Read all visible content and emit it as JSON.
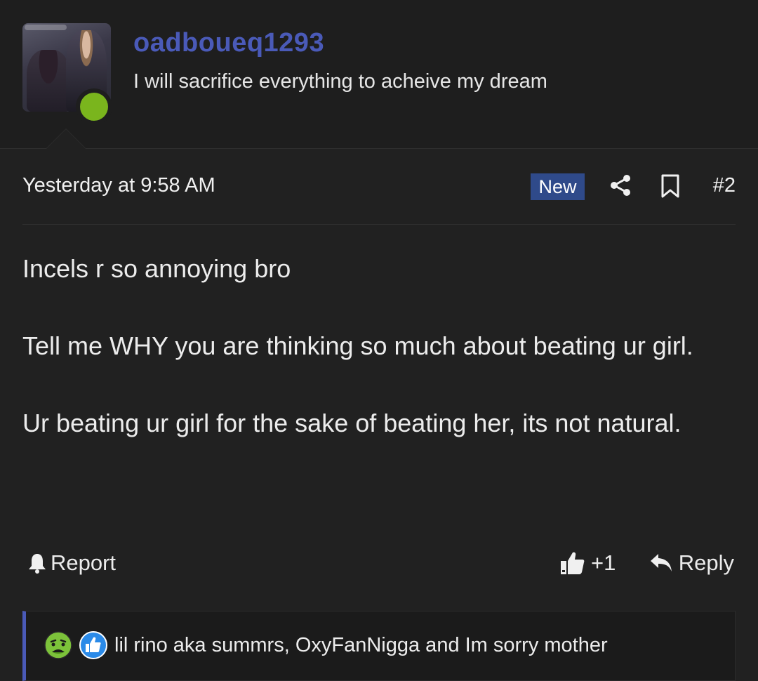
{
  "author": {
    "username": "oadboueq1293",
    "tagline": "I will sacrifice everything to acheive my dream",
    "online_color": "#7ab51d",
    "username_color": "#4a5ab8"
  },
  "post": {
    "timestamp": "Yesterday at 9:58 AM",
    "badge": "New",
    "post_number": "#2",
    "paragraphs": [
      "Incels r so annoying bro",
      "Tell me WHY you are thinking so much about beating ur girl.",
      "Ur beating ur girl for the sake of beating her, its not natural."
    ]
  },
  "actions": {
    "report_label": "Report",
    "like_count": "+1",
    "reply_label": "Reply"
  },
  "reactions": {
    "icons": [
      "sick-emoji-icon",
      "thumbs-up-icon"
    ],
    "names": "lil rino aka summrs, OxyFanNigga and Im sorry mother"
  },
  "colors": {
    "background": "#212121",
    "badge_bg": "#2f4a8a",
    "accent": "#4a5ab8"
  }
}
